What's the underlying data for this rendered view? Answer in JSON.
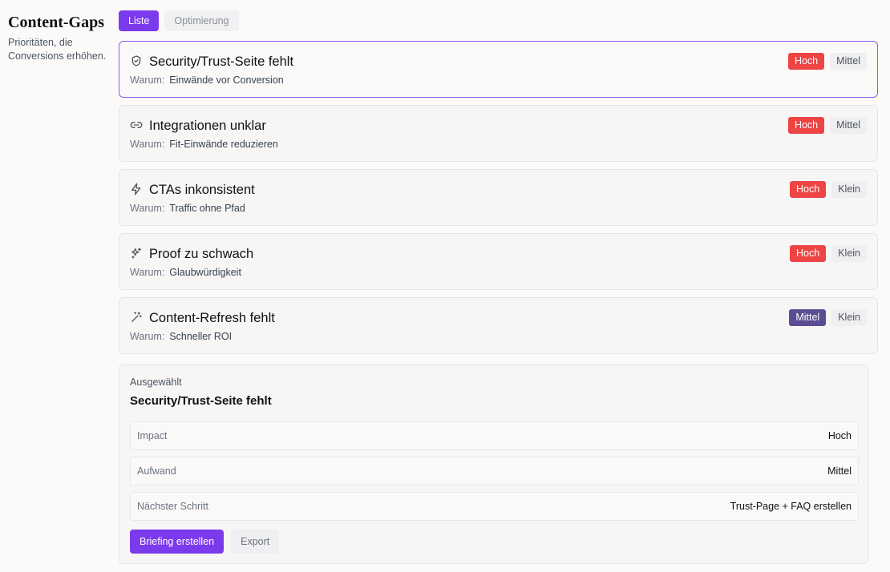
{
  "sidebar": {
    "title": "Content-Gaps",
    "subtitle": "Prioritäten, die Conversions erhöhen."
  },
  "tabs": [
    {
      "label": "Liste",
      "active": true
    },
    {
      "label": "Optimierung",
      "active": false
    }
  ],
  "colors": {
    "accent": "#7c3aed",
    "hoch": "#ef4444",
    "mittel_impact": "#5b4d91"
  },
  "items": [
    {
      "icon": "shield-icon",
      "title": "Security/Trust-Seite fehlt",
      "why_label": "Warum:",
      "why": "Einwände vor Conversion",
      "impact": "Hoch",
      "effort": "Mittel",
      "impact_color": "#ef4444"
    },
    {
      "icon": "link-icon",
      "title": "Integrationen unklar",
      "why_label": "Warum:",
      "why": "Fit-Einwände reduzieren",
      "impact": "Hoch",
      "effort": "Mittel",
      "impact_color": "#ef4444"
    },
    {
      "icon": "zap-icon",
      "title": "CTAs inkonsistent",
      "why_label": "Warum:",
      "why": "Traffic ohne Pfad",
      "impact": "Hoch",
      "effort": "Klein",
      "impact_color": "#ef4444"
    },
    {
      "icon": "sparkles-icon",
      "title": "Proof zu schwach",
      "why_label": "Warum:",
      "why": "Glaubwürdigkeit",
      "impact": "Hoch",
      "effort": "Klein",
      "impact_color": "#ef4444"
    },
    {
      "icon": "wand-icon",
      "title": "Content-Refresh fehlt",
      "why_label": "Warum:",
      "why": "Schneller ROI",
      "impact": "Mittel",
      "effort": "Klein",
      "impact_color": "#5b4d91"
    }
  ],
  "detail": {
    "label": "Ausgewählt",
    "title": "Security/Trust-Seite fehlt",
    "rows": [
      {
        "key": "Impact",
        "value": "Hoch"
      },
      {
        "key": "Aufwand",
        "value": "Mittel"
      },
      {
        "key": "Nächster Schritt",
        "value": "Trust-Page + FAQ erstellen"
      }
    ],
    "primary_button": "Briefing erstellen",
    "secondary_button": "Export"
  }
}
